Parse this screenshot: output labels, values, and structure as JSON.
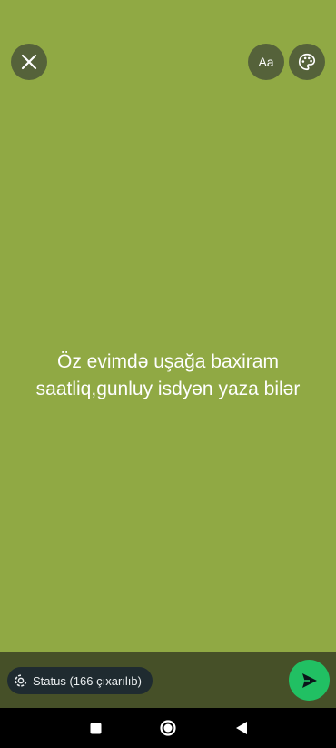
{
  "colors": {
    "background": "#90a944",
    "button_bg": "#55623a",
    "bottom_bar": "#465028",
    "chip_bg": "#1f2b30",
    "send": "#21c063"
  },
  "toolbar": {
    "close_icon": "close-icon",
    "font_label": "Aa",
    "palette_icon": "palette-icon"
  },
  "status": {
    "line1": "Öz evimdə uşağa baxiram",
    "line2": "saatliq,gunluy isdyən yaza bilər"
  },
  "bottom": {
    "audience_label": "Status (166 çıxarılıb)",
    "audience_icon": "status-icon",
    "send_icon": "send-icon"
  },
  "navbar": {
    "recents_icon": "recents-icon",
    "home_icon": "home-icon",
    "back_icon": "back-icon"
  }
}
